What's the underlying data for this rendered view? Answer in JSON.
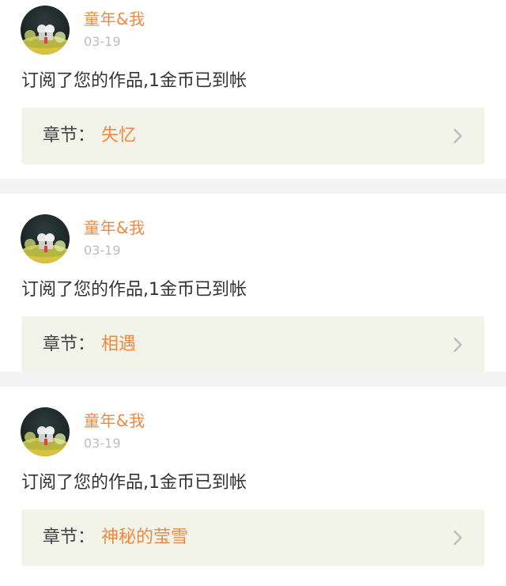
{
  "notifications": [
    {
      "user": "童年&我",
      "date": "03-19",
      "message": "订阅了您的作品,1金币已到帐",
      "chapter_label": "章节：",
      "chapter_title": "失忆",
      "avatar_icon": "user-avatar-photo",
      "chevron_icon": "chevron-right-icon"
    },
    {
      "user": "童年&我",
      "date": "03-19",
      "message": "订阅了您的作品,1金币已到帐",
      "chapter_label": "章节：",
      "chapter_title": "相遇",
      "avatar_icon": "user-avatar-photo",
      "chevron_icon": "chevron-right-icon"
    },
    {
      "user": "童年&我",
      "date": "03-19",
      "message": "订阅了您的作品,1金币已到帐",
      "chapter_label": "章节：",
      "chapter_title": "神秘的莹雪",
      "avatar_icon": "user-avatar-photo",
      "chevron_icon": "chevron-right-icon"
    }
  ],
  "colors": {
    "accent": "#f0883d",
    "date": "#bdbdbd",
    "text": "#333333",
    "chapter_bg": "#f2f4ea",
    "page_bg": "#f3f3f3"
  }
}
